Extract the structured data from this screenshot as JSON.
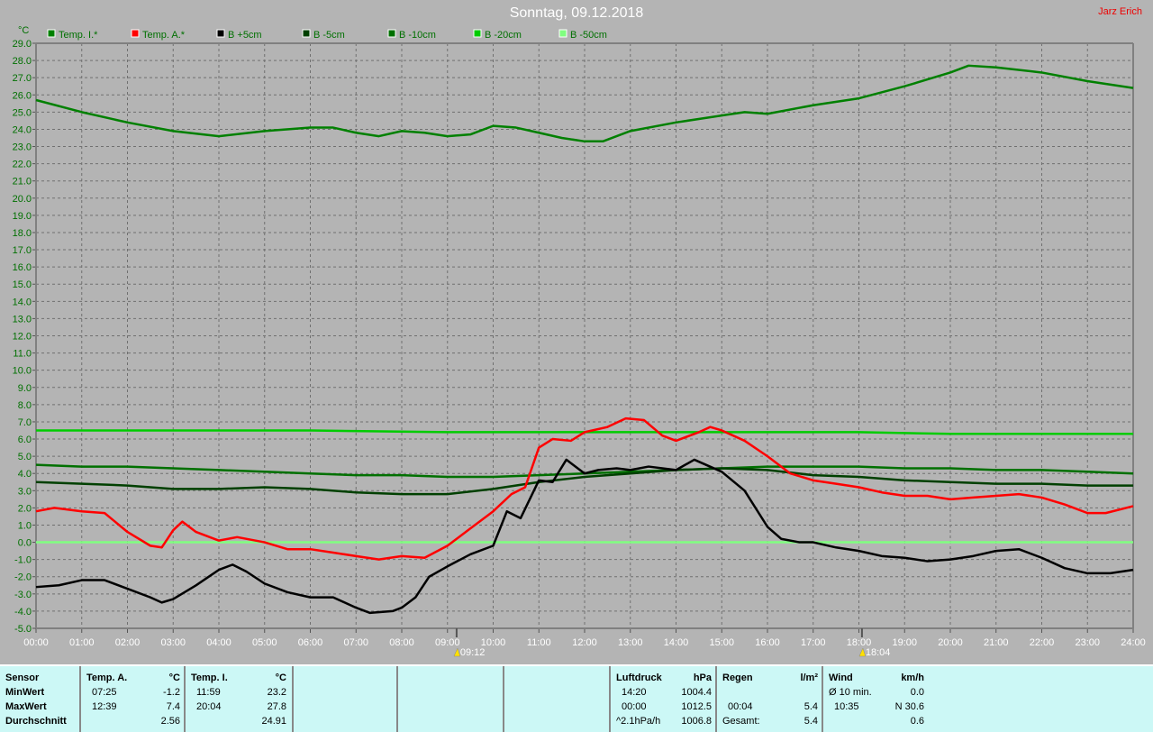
{
  "title": "Sonntag, 09.12.2018",
  "author": "Jarz Erich",
  "markers": [
    {
      "time": "09:12",
      "hour": 9.2,
      "icon": "sunrise-icon"
    },
    {
      "time": "18:04",
      "hour": 18.067,
      "icon": "sunset-icon"
    }
  ],
  "chart_data": {
    "type": "line",
    "ylabel": "°C",
    "ylim": [
      -5,
      29
    ],
    "xlim": [
      0,
      24
    ],
    "grid": true,
    "legend": "top",
    "xticks": [
      "00:00",
      "01:00",
      "02:00",
      "03:00",
      "04:00",
      "05:00",
      "06:00",
      "07:00",
      "08:00",
      "09:00",
      "10:00",
      "11:00",
      "12:00",
      "13:00",
      "14:00",
      "15:00",
      "16:00",
      "17:00",
      "18:00",
      "19:00",
      "20:00",
      "21:00",
      "22:00",
      "23:00",
      "24:00"
    ],
    "series": [
      {
        "name": "Temp. I.*",
        "color": "#008000",
        "points": [
          [
            0,
            25.7
          ],
          [
            1,
            25.0
          ],
          [
            2,
            24.4
          ],
          [
            3,
            23.9
          ],
          [
            4,
            23.6
          ],
          [
            5,
            23.9
          ],
          [
            6,
            24.1
          ],
          [
            6.5,
            24.1
          ],
          [
            7,
            23.8
          ],
          [
            7.5,
            23.6
          ],
          [
            8,
            23.9
          ],
          [
            8.5,
            23.8
          ],
          [
            9,
            23.6
          ],
          [
            9.5,
            23.7
          ],
          [
            10,
            24.2
          ],
          [
            10.5,
            24.1
          ],
          [
            11,
            23.8
          ],
          [
            11.5,
            23.5
          ],
          [
            12,
            23.3
          ],
          [
            12.4,
            23.3
          ],
          [
            13,
            23.9
          ],
          [
            14,
            24.4
          ],
          [
            15,
            24.8
          ],
          [
            15.5,
            25.0
          ],
          [
            16,
            24.9
          ],
          [
            17,
            25.4
          ],
          [
            18,
            25.8
          ],
          [
            19,
            26.5
          ],
          [
            20,
            27.3
          ],
          [
            20.4,
            27.7
          ],
          [
            21,
            27.6
          ],
          [
            22,
            27.3
          ],
          [
            23,
            26.8
          ],
          [
            24,
            26.4
          ]
        ]
      },
      {
        "name": "Temp. A.*",
        "color": "#ff0000",
        "points": [
          [
            0,
            1.8
          ],
          [
            0.4,
            2.0
          ],
          [
            1,
            1.8
          ],
          [
            1.5,
            1.7
          ],
          [
            2,
            0.6
          ],
          [
            2.5,
            -0.2
          ],
          [
            2.75,
            -0.3
          ],
          [
            3,
            0.7
          ],
          [
            3.2,
            1.2
          ],
          [
            3.5,
            0.6
          ],
          [
            4,
            0.1
          ],
          [
            4.4,
            0.3
          ],
          [
            5,
            0.0
          ],
          [
            5.5,
            -0.4
          ],
          [
            6,
            -0.4
          ],
          [
            6.5,
            -0.6
          ],
          [
            7,
            -0.8
          ],
          [
            7.5,
            -1.0
          ],
          [
            8,
            -0.8
          ],
          [
            8.5,
            -0.9
          ],
          [
            9,
            -0.2
          ],
          [
            9.5,
            0.8
          ],
          [
            10,
            1.8
          ],
          [
            10.4,
            2.8
          ],
          [
            10.7,
            3.2
          ],
          [
            11,
            5.5
          ],
          [
            11.3,
            6.0
          ],
          [
            11.7,
            5.9
          ],
          [
            12,
            6.4
          ],
          [
            12.5,
            6.7
          ],
          [
            12.9,
            7.2
          ],
          [
            13.3,
            7.1
          ],
          [
            13.7,
            6.2
          ],
          [
            14,
            5.9
          ],
          [
            14.5,
            6.4
          ],
          [
            14.75,
            6.7
          ],
          [
            15,
            6.5
          ],
          [
            15.5,
            5.9
          ],
          [
            16,
            5.0
          ],
          [
            16.5,
            4.0
          ],
          [
            17,
            3.6
          ],
          [
            17.5,
            3.4
          ],
          [
            18,
            3.2
          ],
          [
            18.5,
            2.9
          ],
          [
            19,
            2.7
          ],
          [
            19.5,
            2.7
          ],
          [
            20,
            2.5
          ],
          [
            20.5,
            2.6
          ],
          [
            21,
            2.7
          ],
          [
            21.5,
            2.8
          ],
          [
            22,
            2.6
          ],
          [
            22.5,
            2.2
          ],
          [
            23,
            1.7
          ],
          [
            23.4,
            1.7
          ],
          [
            24,
            2.1
          ]
        ]
      },
      {
        "name": "B +5cm",
        "color": "#000000",
        "points": [
          [
            0,
            -2.6
          ],
          [
            0.5,
            -2.5
          ],
          [
            1,
            -2.2
          ],
          [
            1.5,
            -2.2
          ],
          [
            2,
            -2.7
          ],
          [
            2.5,
            -3.2
          ],
          [
            2.75,
            -3.5
          ],
          [
            3,
            -3.3
          ],
          [
            3.5,
            -2.5
          ],
          [
            4,
            -1.6
          ],
          [
            4.3,
            -1.3
          ],
          [
            4.6,
            -1.7
          ],
          [
            5,
            -2.4
          ],
          [
            5.5,
            -2.9
          ],
          [
            6,
            -3.2
          ],
          [
            6.5,
            -3.2
          ],
          [
            7,
            -3.8
          ],
          [
            7.3,
            -4.1
          ],
          [
            7.8,
            -4.0
          ],
          [
            8,
            -3.8
          ],
          [
            8.3,
            -3.2
          ],
          [
            8.6,
            -2.0
          ],
          [
            9,
            -1.4
          ],
          [
            9.5,
            -0.7
          ],
          [
            10,
            -0.2
          ],
          [
            10.3,
            1.8
          ],
          [
            10.6,
            1.4
          ],
          [
            11,
            3.6
          ],
          [
            11.3,
            3.5
          ],
          [
            11.6,
            4.8
          ],
          [
            12,
            4.0
          ],
          [
            12.3,
            4.2
          ],
          [
            12.7,
            4.3
          ],
          [
            13,
            4.2
          ],
          [
            13.4,
            4.4
          ],
          [
            14,
            4.2
          ],
          [
            14.4,
            4.8
          ],
          [
            15,
            4.1
          ],
          [
            15.5,
            3.0
          ],
          [
            16,
            0.9
          ],
          [
            16.3,
            0.2
          ],
          [
            16.7,
            0.0
          ],
          [
            17,
            0.0
          ],
          [
            17.5,
            -0.3
          ],
          [
            18,
            -0.5
          ],
          [
            18.5,
            -0.8
          ],
          [
            19,
            -0.9
          ],
          [
            19.5,
            -1.1
          ],
          [
            20,
            -1.0
          ],
          [
            20.5,
            -0.8
          ],
          [
            21,
            -0.5
          ],
          [
            21.5,
            -0.4
          ],
          [
            22,
            -0.9
          ],
          [
            22.5,
            -1.5
          ],
          [
            23,
            -1.8
          ],
          [
            23.5,
            -1.8
          ],
          [
            24,
            -1.6
          ]
        ]
      },
      {
        "name": "B -5cm",
        "color": "#004000",
        "points": [
          [
            0,
            3.5
          ],
          [
            1,
            3.4
          ],
          [
            2,
            3.3
          ],
          [
            3,
            3.1
          ],
          [
            4,
            3.1
          ],
          [
            5,
            3.2
          ],
          [
            6,
            3.1
          ],
          [
            7,
            2.9
          ],
          [
            8,
            2.8
          ],
          [
            9,
            2.8
          ],
          [
            10,
            3.1
          ],
          [
            11,
            3.5
          ],
          [
            12,
            3.8
          ],
          [
            13,
            4.0
          ],
          [
            14,
            4.2
          ],
          [
            15,
            4.3
          ],
          [
            16,
            4.2
          ],
          [
            17,
            3.9
          ],
          [
            18,
            3.8
          ],
          [
            19,
            3.6
          ],
          [
            20,
            3.5
          ],
          [
            21,
            3.4
          ],
          [
            22,
            3.4
          ],
          [
            23,
            3.3
          ],
          [
            24,
            3.3
          ]
        ]
      },
      {
        "name": "B -10cm",
        "color": "#007000",
        "points": [
          [
            0,
            4.5
          ],
          [
            1,
            4.4
          ],
          [
            2,
            4.4
          ],
          [
            3,
            4.3
          ],
          [
            4,
            4.2
          ],
          [
            5,
            4.1
          ],
          [
            6,
            4.0
          ],
          [
            7,
            3.9
          ],
          [
            8,
            3.9
          ],
          [
            9,
            3.8
          ],
          [
            10,
            3.8
          ],
          [
            11,
            3.9
          ],
          [
            12,
            4.0
          ],
          [
            13,
            4.1
          ],
          [
            14,
            4.2
          ],
          [
            15,
            4.3
          ],
          [
            16,
            4.4
          ],
          [
            17,
            4.4
          ],
          [
            18,
            4.4
          ],
          [
            19,
            4.3
          ],
          [
            20,
            4.3
          ],
          [
            21,
            4.2
          ],
          [
            22,
            4.2
          ],
          [
            23,
            4.1
          ],
          [
            24,
            4.0
          ]
        ]
      },
      {
        "name": "B -20cm",
        "color": "#00cc00",
        "points": [
          [
            0,
            6.5
          ],
          [
            3,
            6.5
          ],
          [
            6,
            6.5
          ],
          [
            9,
            6.4
          ],
          [
            12,
            6.4
          ],
          [
            15,
            6.4
          ],
          [
            18,
            6.4
          ],
          [
            20,
            6.3
          ],
          [
            24,
            6.3
          ]
        ]
      },
      {
        "name": "B -50cm",
        "color": "#80ff80",
        "points": [
          [
            0,
            0.0
          ],
          [
            24,
            0.0
          ]
        ]
      }
    ]
  },
  "table": {
    "sensor": {
      "header": "Sensor",
      "rows": [
        "MinWert",
        "MaxWert",
        "Durchschnitt"
      ]
    },
    "temp_a": {
      "header": "Temp. A.",
      "unit": "°C",
      "min_time": "07:25",
      "min": "-1.2",
      "max_time": "12:39",
      "max": "7.4",
      "avg": "2.56"
    },
    "temp_i": {
      "header": "Temp. I.",
      "unit": "°C",
      "min_time": "11:59",
      "min": "23.2",
      "max_time": "20:04",
      "max": "27.8",
      "avg": "24.91"
    },
    "pressure": {
      "header": "Luftdruck",
      "unit": "hPa",
      "min_time": "14:20",
      "min": "1004.4",
      "max_time": "00:00",
      "max": "1012.5",
      "trend": "^2.1hPa/h",
      "avg": "1006.8"
    },
    "rain": {
      "header": "Regen",
      "unit": "l/m²",
      "max_time": "00:04",
      "max": "5.4",
      "total_label": "Gesamt:",
      "total": "5.4"
    },
    "wind": {
      "header": "Wind",
      "unit": "km/h",
      "avg_label": "Ø 10 min.",
      "avg10": "0.0",
      "max_time": "10:35",
      "max": "N 30.6",
      "avg": "0.6"
    }
  }
}
